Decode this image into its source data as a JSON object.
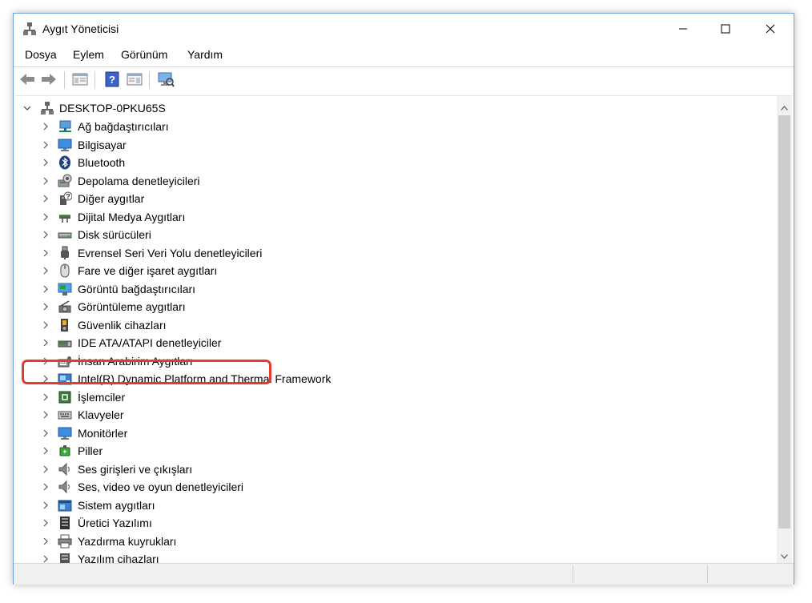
{
  "window": {
    "title": "Aygıt Yöneticisi",
    "icon": "device-manager-icon",
    "controls": [
      "minimize-icon",
      "maximize-icon",
      "close-icon"
    ]
  },
  "menu": [
    "Dosya",
    "Eylem",
    "Görünüm",
    "Yardım"
  ],
  "toolbar": [
    "back-arrow-icon",
    "forward-arrow-icon",
    "properties-icon",
    "help-icon",
    "update-driver-icon",
    "scan-hardware-icon"
  ],
  "tree": {
    "root": "DESKTOP-0PKU65S",
    "items": [
      {
        "label": "Ağ bağdaştırıcıları",
        "icon": "network-adapter-icon"
      },
      {
        "label": "Bilgisayar",
        "icon": "computer-icon"
      },
      {
        "label": "Bluetooth",
        "icon": "bluetooth-icon"
      },
      {
        "label": "Depolama denetleyicileri",
        "icon": "storage-controller-icon"
      },
      {
        "label": "Diğer aygıtlar",
        "icon": "other-devices-icon"
      },
      {
        "label": "Dijital Medya Aygıtları",
        "icon": "digital-media-icon"
      },
      {
        "label": "Disk sürücüleri",
        "icon": "disk-drive-icon"
      },
      {
        "label": "Evrensel Seri Veri Yolu denetleyicileri",
        "icon": "usb-icon"
      },
      {
        "label": "Fare ve diğer işaret aygıtları",
        "icon": "mouse-icon"
      },
      {
        "label": "Görüntü bağdaştırıcıları",
        "icon": "display-adapter-icon"
      },
      {
        "label": "Görüntüleme aygıtları",
        "icon": "imaging-device-icon"
      },
      {
        "label": "Güvenlik cihazları",
        "icon": "security-device-icon"
      },
      {
        "label": "IDE ATA/ATAPI denetleyiciler",
        "icon": "ide-controller-icon"
      },
      {
        "label": "İnsan Arabirim Aygıtları",
        "icon": "hid-icon"
      },
      {
        "label": "Intel(R) Dynamic Platform and Thermal Framework",
        "icon": "thermal-framework-icon"
      },
      {
        "label": "İşlemciler",
        "icon": "processor-icon"
      },
      {
        "label": "Klavyeler",
        "icon": "keyboard-icon"
      },
      {
        "label": "Monitörler",
        "icon": "monitor-icon"
      },
      {
        "label": "Piller",
        "icon": "battery-icon"
      },
      {
        "label": "Ses girişleri ve çıkışları",
        "icon": "audio-io-icon"
      },
      {
        "label": "Ses, video ve oyun denetleyicileri",
        "icon": "sound-video-icon"
      },
      {
        "label": "Sistem aygıtları",
        "icon": "system-devices-icon"
      },
      {
        "label": "Üretici Yazılımı",
        "icon": "firmware-icon"
      },
      {
        "label": "Yazdırma kuyrukları",
        "icon": "print-queue-icon"
      },
      {
        "label": "Yazılım cihazları",
        "icon": "software-device-icon"
      }
    ]
  },
  "highlighted_item": "İnsan Arabirim Aygıtları",
  "colors": {
    "highlight": "#e53a2e",
    "window_border": "#6f9fd8",
    "icon_blue": "#3c7fc7"
  }
}
